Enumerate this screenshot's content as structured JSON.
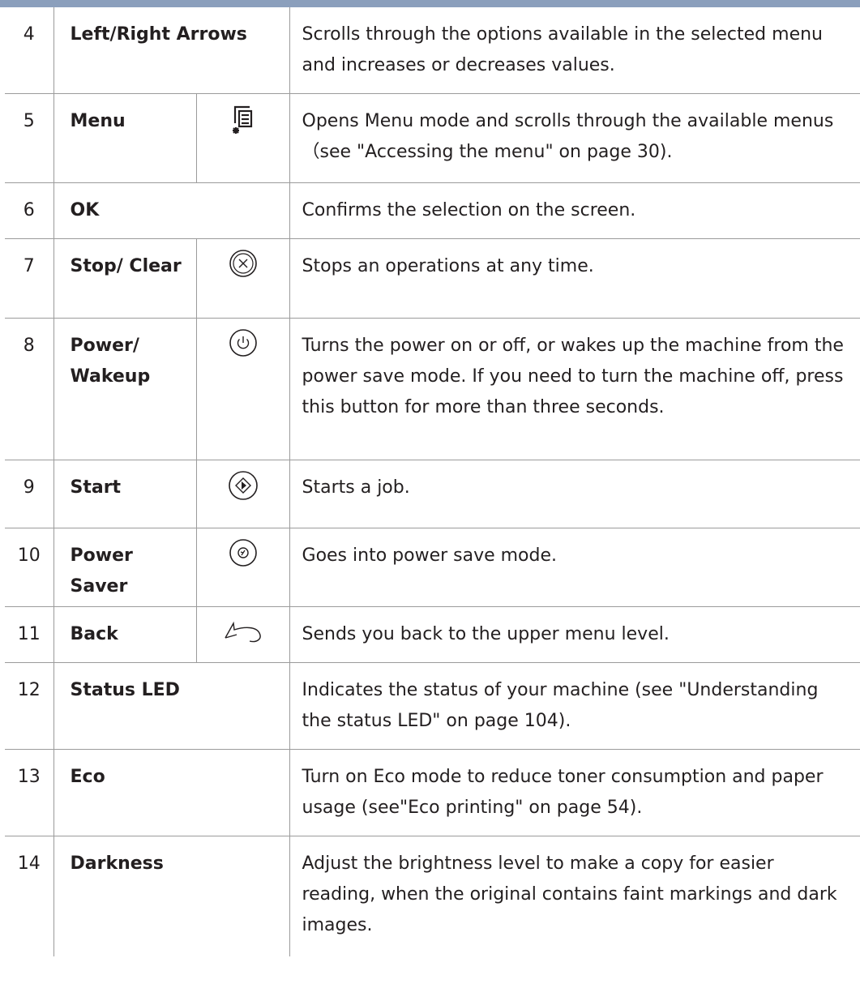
{
  "rows": [
    {
      "num": "4",
      "name": "Left/Right Arrows",
      "icon": null,
      "desc": "Scrolls through the options available in the selected menu and increases or decreases values."
    },
    {
      "num": "5",
      "name": "Menu",
      "icon": "menu-icon",
      "desc": "Opens Menu mode and scrolls through the available menus（see \"Accessing the menu\" on page 30)."
    },
    {
      "num": "6",
      "name": "OK",
      "icon": null,
      "desc": "Confirms the selection on the screen."
    },
    {
      "num": "7",
      "name": "Stop/ Clear",
      "icon": "stop-clear-icon",
      "desc": "Stops an operations at any time."
    },
    {
      "num": "8",
      "name": "Power/ Wakeup",
      "icon": "power-icon",
      "desc": "Turns the power on or off, or wakes up the machine from the power save mode. If you need to turn the machine off, press this button for more than three seconds."
    },
    {
      "num": "9",
      "name": "Start",
      "icon": "start-icon",
      "desc": "Starts a job."
    },
    {
      "num": "10",
      "name": "Power Saver",
      "icon": "power-saver-icon",
      "desc": "Goes into power save mode."
    },
    {
      "num": "11",
      "name": "Back",
      "icon": "back-icon",
      "desc": "Sends you back to the upper menu level."
    },
    {
      "num": "12",
      "name": "Status LED",
      "icon": null,
      "desc": "Indicates the status of your machine (see \"Understanding the status LED\" on page 104)."
    },
    {
      "num": "13",
      "name": "Eco",
      "icon": null,
      "desc": "Turn on Eco mode to reduce toner consumption and paper usage (see\"Eco printing\" on page 54)."
    },
    {
      "num": "14",
      "name": "Darkness",
      "icon": null,
      "desc": "Adjust the brightness level to make a copy for easier reading, when the original contains faint markings and dark images."
    }
  ]
}
